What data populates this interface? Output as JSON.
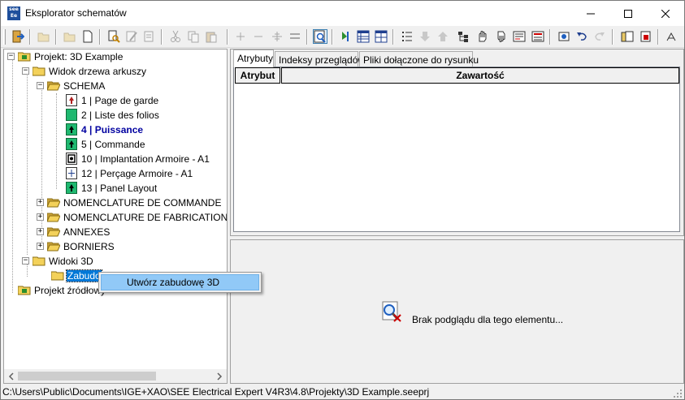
{
  "window": {
    "title": "Eksplorator schematów",
    "icon_text": "see Ee"
  },
  "toolbar": {
    "icons": [
      "exit-icon",
      "open-icon",
      "open-folder-icon",
      "new-document-icon",
      "find-icon",
      "edit-icon",
      "rename-icon",
      "cut-icon",
      "copy-icon",
      "paste-icon",
      "zoom-in-icon",
      "zoom-out-icon",
      "insert-icon",
      "align-icon",
      "preview-icon",
      "refresh-icon",
      "grid-icon",
      "table-icon",
      "list-icon",
      "move-down-icon",
      "move-up-icon",
      "tree-icon",
      "drag-icon",
      "drag-down-icon",
      "report-icon",
      "report2-icon",
      "settings-icon",
      "undo-icon",
      "redo-icon",
      "book-icon",
      "book2-icon",
      "sort-icon"
    ]
  },
  "tree": {
    "project_root": "Projekt: 3D Example",
    "sheet_view": "Widok drzewa arkuszy",
    "schema": "SCHEMA",
    "pages": [
      {
        "label": "1 | Page de garde",
        "bold": false
      },
      {
        "label": "2 | Liste des folios",
        "bold": false
      },
      {
        "label": "4 | Puissance",
        "bold": true
      },
      {
        "label": "5 | Commande",
        "bold": false
      },
      {
        "label": "10 | Implantation Armoire - A1",
        "bold": false
      },
      {
        "label": "12 | Perçage Armoire - A1",
        "bold": false
      },
      {
        "label": "13 | Panel Layout",
        "bold": false
      }
    ],
    "folders": [
      "NOMENCLATURE DE COMMANDE",
      "NOMENCLATURE DE FABRICATION",
      "ANNEXES",
      "BORNIERS"
    ],
    "views_3d": "Widoki 3D",
    "selected_item": "Zabudo",
    "source_project": "Projekt źródłowy"
  },
  "tabs": [
    "Atrybuty",
    "Indeksy przeglądów",
    "Pliki dołączone do rysunku"
  ],
  "grid": {
    "columns": [
      "Atrybut",
      "Zawartość"
    ]
  },
  "preview": {
    "message": "Brak podglądu dla tego elementu..."
  },
  "context_menu": {
    "items": [
      "Utwórz zabudowę 3D"
    ]
  },
  "statusbar": {
    "path": "C:\\Users\\Public\\Documents\\IGE+XAO\\SEE Electrical Expert V4R3\\4.8\\Projekty\\3D Example.seeprj"
  },
  "colors": {
    "selection": "#0078d7",
    "highlight_text": "#0000a0",
    "menu_hover": "#91c9f7"
  }
}
